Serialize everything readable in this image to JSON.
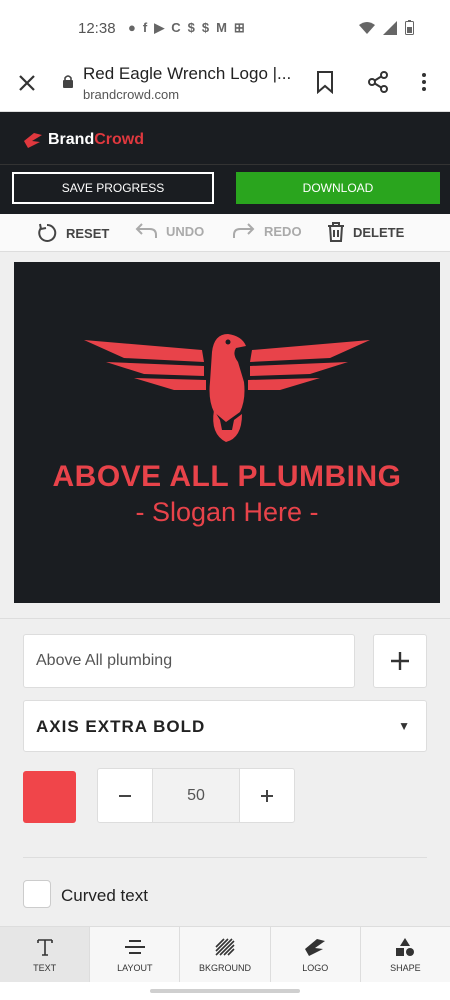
{
  "status_bar": {
    "time": "12:38",
    "notification_icons": [
      "chat-icon",
      "facebook-icon",
      "youtube-icon",
      "c-icon",
      "dollar-icon",
      "dollar-icon",
      "gmail-icon",
      "gift-icon"
    ],
    "notification_glyphs": [
      "●",
      "f",
      "▶",
      "C",
      "$",
      "$",
      "M",
      "⊞"
    ]
  },
  "browser": {
    "page_title": "Red Eagle Wrench Logo |...",
    "url": "brandcrowd.com"
  },
  "brand": {
    "part1": "Brand",
    "part2": "Crowd",
    "accent": "#e0383e"
  },
  "actions": {
    "save_label": "SAVE PROGRESS",
    "download_label": "DOWNLOAD",
    "download_color": "#2aa51e"
  },
  "toolbar": {
    "reset": "RESET",
    "undo": "UNDO",
    "redo": "REDO",
    "delete": "DELETE"
  },
  "logo": {
    "main_text": "ABOVE ALL PLUMBING",
    "slogan": "- Slogan Here -",
    "color": "#e8434a",
    "background": "#1a1d21"
  },
  "editor": {
    "text_value": "Above All plumbing",
    "font_name": "AXIS EXTRA BOLD",
    "color_swatch": "#f0454a",
    "size_value": "50",
    "curved_text_label": "Curved text",
    "curved_text_checked": false
  },
  "tabs": [
    {
      "label": "TEXT",
      "icon": "text-icon",
      "active": true
    },
    {
      "label": "LAYOUT",
      "icon": "layout-icon",
      "active": false
    },
    {
      "label": "BKGROUND",
      "icon": "background-icon",
      "active": false
    },
    {
      "label": "LOGO",
      "icon": "logo-icon",
      "active": false
    },
    {
      "label": "SHAPE",
      "icon": "shape-icon",
      "active": false
    }
  ]
}
